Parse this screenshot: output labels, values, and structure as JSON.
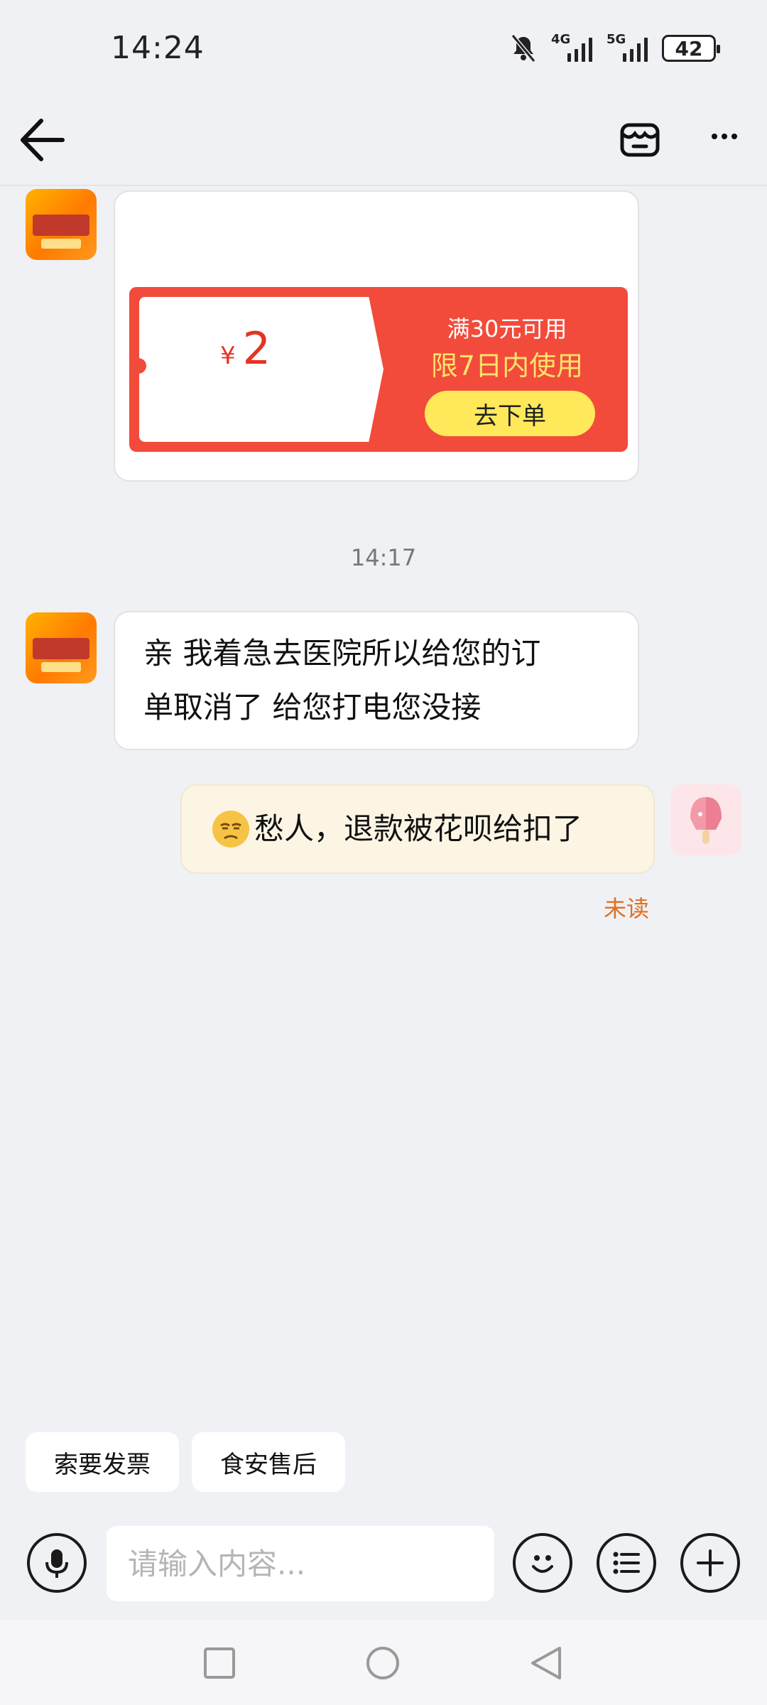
{
  "status_bar": {
    "time": "14:24",
    "signal_1_label": "4G",
    "signal_2_label": "5G",
    "battery": "42"
  },
  "header": {
    "back_icon": "arrow-left-icon",
    "store_icon": "store-icon",
    "more_icon": "more-dots-icon"
  },
  "coupon": {
    "currency": "¥",
    "amount": "2",
    "condition": "满30元可用",
    "validity": "限7日内使用",
    "order_button": "去下单"
  },
  "timestamp": "14:17",
  "messages": [
    {
      "from": "shop",
      "text_line1": "亲 我着急去医院所以给您的订",
      "text_line2": "单取消了 给您打电您没接"
    },
    {
      "from": "me",
      "emoji": "sad-face-emoji",
      "text": "愁人，退款被花呗给扣了",
      "status": "未读"
    }
  ],
  "quick_replies": [
    "索要发票",
    "食安售后"
  ],
  "input": {
    "placeholder": "请输入内容..."
  },
  "colors": {
    "accent": "#f24b3b",
    "unread": "#e0701e",
    "coupon_button": "#ffe85a"
  }
}
